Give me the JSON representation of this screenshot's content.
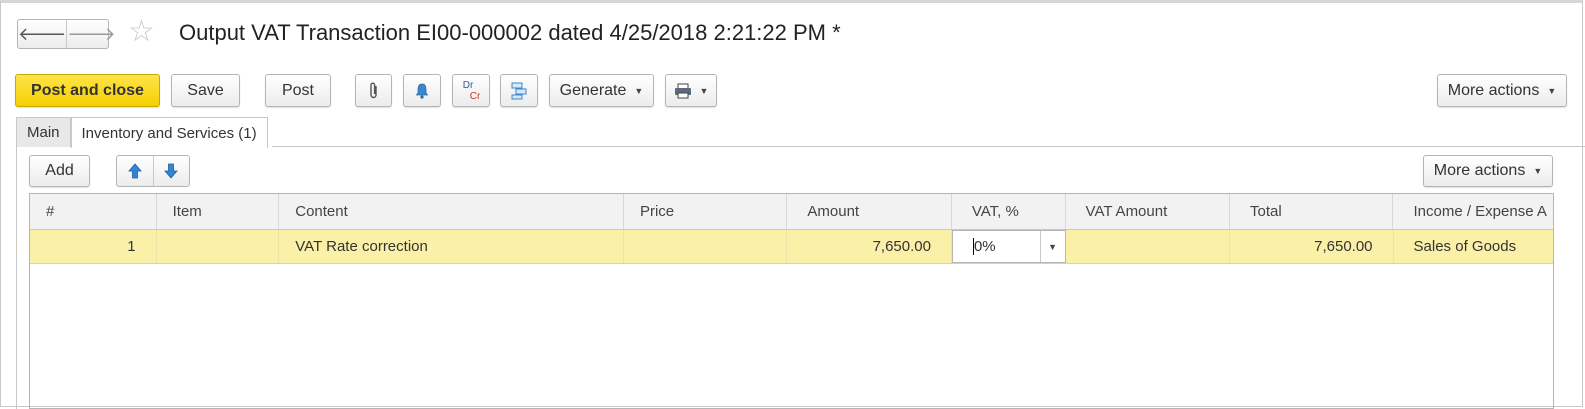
{
  "window": {
    "title": "Output VAT Transaction EI00-000002 dated 4/25/2018 2:21:22 PM *",
    "back": "🡐",
    "forward": "🡒"
  },
  "toolbar": {
    "post_and_close": "Post and close",
    "save": "Save",
    "post": "Post",
    "drcr_top": "Dr",
    "drcr_bottom": "Cr",
    "generate": "Generate",
    "more_actions": "More actions"
  },
  "tabs": [
    {
      "label": "Main",
      "active": false
    },
    {
      "label": "Inventory and Services (1)",
      "active": true
    }
  ],
  "table_toolbar": {
    "add": "Add",
    "more_actions": "More actions"
  },
  "table": {
    "columns": [
      "#",
      "Item",
      "Content",
      "Price",
      "Amount",
      "VAT, %",
      "VAT Amount",
      "Total",
      "Income / Expense A"
    ],
    "rows": [
      {
        "num": "1",
        "item": "",
        "content": "VAT Rate correction",
        "price": "",
        "amount": "7,650.00",
        "vat_rate": "0%",
        "vat_amount": "",
        "total": "7,650.00",
        "income_expense": "Sales of Goods"
      }
    ]
  },
  "colors": {
    "primary_button": "#f5d000",
    "selected_row": "#fbf0a7",
    "arrow_blue": "#2f86d6"
  }
}
